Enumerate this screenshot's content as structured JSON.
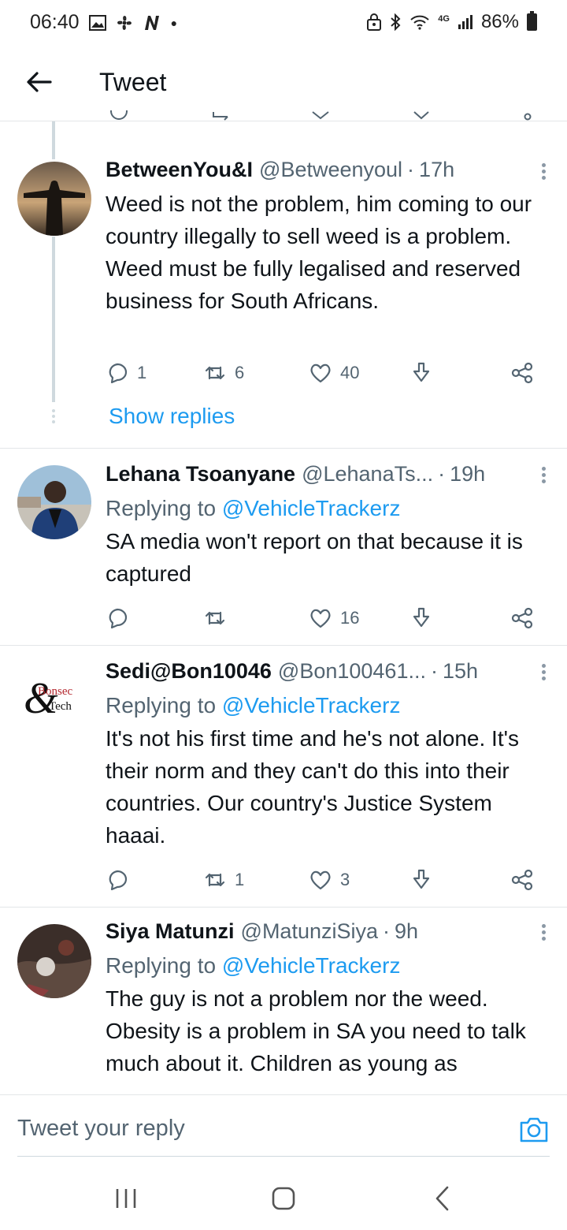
{
  "status_bar": {
    "time": "06:40",
    "network": "4G",
    "battery": "86%"
  },
  "header": {
    "title": "Tweet"
  },
  "thread": {
    "show_replies_label": "Show replies"
  },
  "tweets": [
    {
      "name": "BetweenYou&I",
      "handle": "@Betweenyoul",
      "time": "17h",
      "text": "Weed is not the problem, him coming to our country illegally to sell weed is a problem. Weed must be fully legalised and reserved business for South Africans.",
      "replies": "1",
      "retweets": "6",
      "likes": "40"
    },
    {
      "name": "Lehana Tsoanyane",
      "handle": "@LehanaTs...",
      "time": "19h",
      "replying_prefix": "Replying to",
      "replying_to": "@VehicleTrackerz",
      "text": "SA media won't report on that because it is captured",
      "replies": "",
      "retweets": "",
      "likes": "16"
    },
    {
      "name": "Sedi@Bon10046",
      "handle": "@Bon100461...",
      "time": "15h",
      "replying_prefix": "Replying to",
      "replying_to": "@VehicleTrackerz",
      "text": "It's not his first time and he's not alone. It's their norm and they can't do this into their countries. Our country's Justice System haaai.",
      "replies": "",
      "retweets": "1",
      "likes": "3",
      "avatar_logo_line1": "Bonsec",
      "avatar_logo_line2": "Tech"
    },
    {
      "name": "Siya Matunzi",
      "handle": "@MatunziSiya",
      "time": "9h",
      "replying_prefix": "Replying to",
      "replying_to": "@VehicleTrackerz",
      "text": "The guy is not a problem nor the weed. Obesity is a problem in SA you need to talk much about it. Children as young as"
    }
  ],
  "reply_bar": {
    "placeholder": "Tweet your reply"
  },
  "colors": {
    "accent": "#1d9bf0",
    "secondary_text": "#536471",
    "divider": "#e3e6e8"
  }
}
